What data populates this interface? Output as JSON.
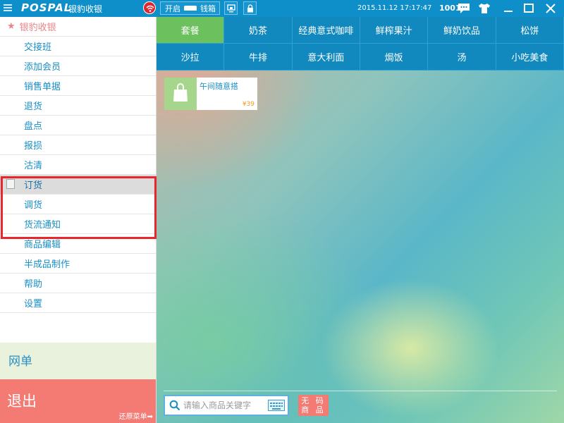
{
  "titlebar": {
    "logo": "POSPAL",
    "app_name": "银豹收银",
    "cash_drawer_label": "开启",
    "cash_drawer_label2": "钱箱",
    "datetime": "2015.11.12 17:17:47",
    "user_id": "1001"
  },
  "sidebar": {
    "header": "银豹收银",
    "items": [
      {
        "label": "交接班"
      },
      {
        "label": "添加会员"
      },
      {
        "label": "销售单据"
      },
      {
        "label": "退货"
      },
      {
        "label": "盘点"
      },
      {
        "label": "报损"
      },
      {
        "label": "沽清"
      },
      {
        "label": "订货",
        "active": true
      },
      {
        "label": "调货"
      },
      {
        "label": "货流通知"
      },
      {
        "label": "商品编辑"
      },
      {
        "label": "半成品制作"
      },
      {
        "label": "帮助"
      },
      {
        "label": "设置"
      }
    ],
    "net_order": "网单",
    "exit": "退出",
    "restore_menu": "还原菜单➡"
  },
  "categories": [
    {
      "label": "套餐",
      "active": true
    },
    {
      "label": "奶茶"
    },
    {
      "label": "经典意式咖啡"
    },
    {
      "label": "鲜榨果汁"
    },
    {
      "label": "鲜奶饮品"
    },
    {
      "label": "松饼"
    },
    {
      "label": "沙拉"
    },
    {
      "label": "牛排"
    },
    {
      "label": "意大利面"
    },
    {
      "label": "焗饭"
    },
    {
      "label": "汤"
    },
    {
      "label": "小吃美食"
    }
  ],
  "products": [
    {
      "name": "午间随意搭",
      "price": "¥39",
      "icon": "shopping-bag-icon"
    }
  ],
  "search": {
    "placeholder": "请输入商品关键字"
  },
  "no_code_button": "无 码\n商 品",
  "no_code_line1": "无 码",
  "no_code_line2": "商 品",
  "colors": {
    "titlebar": "#0f8fc9",
    "category_bg": "#1189bf",
    "category_active": "#6cc05d",
    "exit_bg": "#f47a74",
    "net_order_bg": "#e8f2dc",
    "highlight_border": "#e8262c"
  }
}
